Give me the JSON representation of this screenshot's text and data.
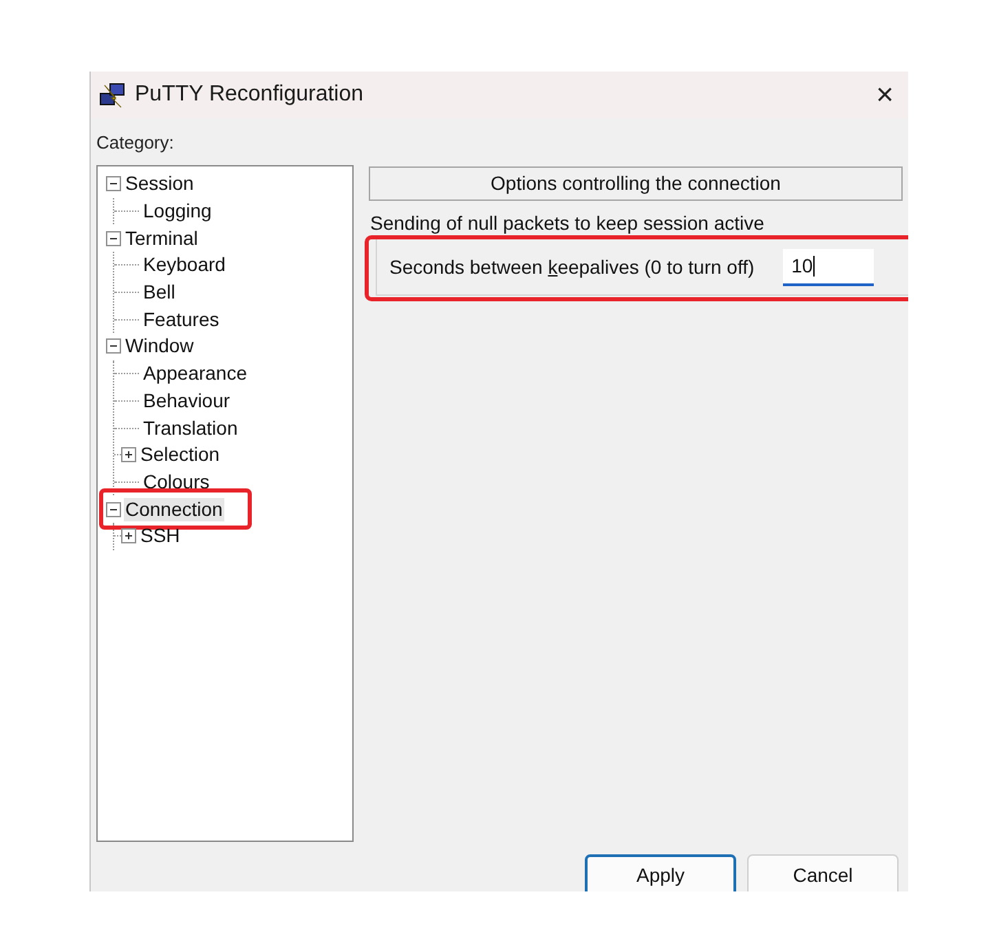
{
  "window": {
    "title": "PuTTY Reconfiguration",
    "close": "×"
  },
  "category_label": "Category:",
  "tree": [
    {
      "label": "Session",
      "expanded": true,
      "selected": false,
      "highlighted": false,
      "children": [
        {
          "label": "Logging",
          "selected": false,
          "highlighted": false
        }
      ]
    },
    {
      "label": "Terminal",
      "expanded": true,
      "selected": false,
      "highlighted": false,
      "children": [
        {
          "label": "Keyboard",
          "selected": false,
          "highlighted": false
        },
        {
          "label": "Bell",
          "selected": false,
          "highlighted": false
        },
        {
          "label": "Features",
          "selected": false,
          "highlighted": false
        }
      ]
    },
    {
      "label": "Window",
      "expanded": true,
      "selected": false,
      "highlighted": false,
      "children": [
        {
          "label": "Appearance",
          "selected": false,
          "highlighted": false
        },
        {
          "label": "Behaviour",
          "selected": false,
          "highlighted": false
        },
        {
          "label": "Translation",
          "selected": false,
          "highlighted": false
        },
        {
          "label": "Selection",
          "expanded": false,
          "selected": false,
          "highlighted": false
        },
        {
          "label": "Colours",
          "selected": false,
          "highlighted": false
        }
      ]
    },
    {
      "label": "Connection",
      "expanded": true,
      "selected": true,
      "highlighted": true,
      "children": [
        {
          "label": "SSH",
          "expanded": false,
          "selected": false,
          "highlighted": false
        }
      ]
    }
  ],
  "panel": {
    "header": "Options controlling the connection",
    "group_title": "Sending of null packets to keep session active",
    "keepalive": {
      "label": "Seconds between **k**eepalives (0 to turn off)",
      "value": "10",
      "focused": true,
      "highlighted": true
    }
  },
  "buttons": [
    {
      "label": "Apply",
      "default": true
    },
    {
      "label": "Cancel",
      "default": false
    }
  ]
}
